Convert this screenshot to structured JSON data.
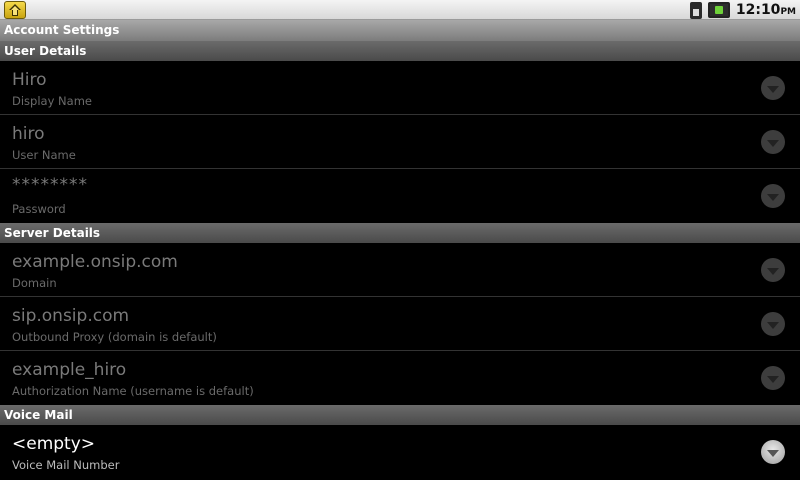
{
  "status_bar": {
    "time": "12:10",
    "ampm": "PM",
    "notification_icon": "app-notification-icon",
    "sim_icon": "sim-card-icon",
    "battery_icon": "battery-icon"
  },
  "title": "Account Settings",
  "sections": [
    {
      "header": "User Details",
      "items": [
        {
          "title": "Hiro",
          "summary": "Display Name"
        },
        {
          "title": "hiro",
          "summary": "User Name"
        },
        {
          "title": "********",
          "summary": "Password"
        }
      ]
    },
    {
      "header": "Server Details",
      "items": [
        {
          "title": "example.onsip.com",
          "summary": "Domain"
        },
        {
          "title": "sip.onsip.com",
          "summary": "Outbound Proxy (domain is default)"
        },
        {
          "title": "example_hiro",
          "summary": "Authorization Name (username is default)"
        }
      ]
    },
    {
      "header": "Voice Mail",
      "items": [
        {
          "title": "<empty>",
          "summary": "Voice Mail Number"
        }
      ]
    }
  ]
}
